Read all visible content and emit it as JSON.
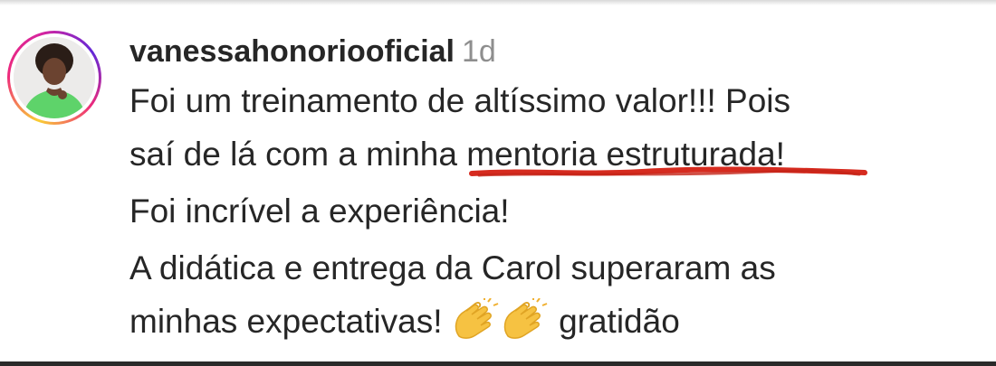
{
  "comment": {
    "username": "vanessahonoriooficial",
    "timestamp": "1d",
    "line1": "Foi um treinamento de altíssimo valor!!! Pois",
    "line2_prefix": "saí de lá com a minha ",
    "line2_highlight": "mentoria estruturada",
    "line2_suffix": "!",
    "line3": "Foi incrível a experiência!",
    "line4": "A didática e entrega da Carol superaram as",
    "line5_prefix": "minhas expectativas! ",
    "line5_suffix": " gratidão",
    "emoji_icons": [
      "clapping-hands-icon",
      "clapping-hands-icon"
    ]
  },
  "colors": {
    "text": "#262626",
    "timestamp": "#8e8e8e",
    "underline_marker": "#d62b1f",
    "story_ring": [
      "#f9ce34",
      "#ee2a7b",
      "#6228d7"
    ]
  }
}
